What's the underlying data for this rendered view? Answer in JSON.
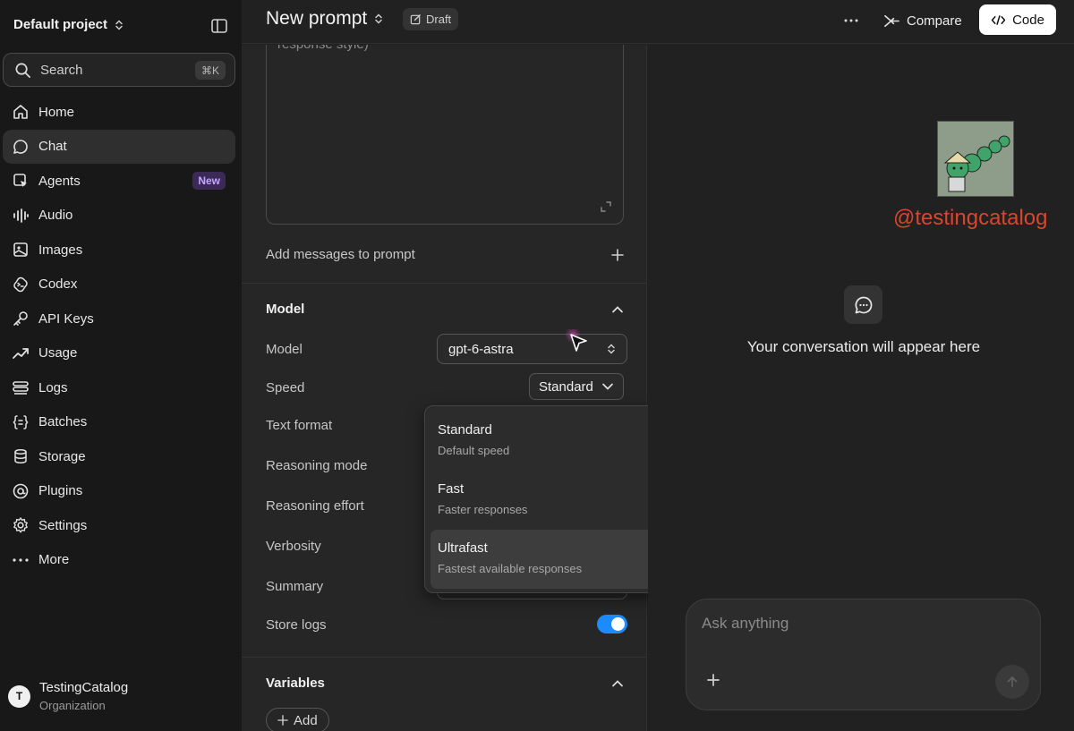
{
  "sidebar": {
    "project": "Default project",
    "search": {
      "label": "Search",
      "shortcut": "⌘K"
    },
    "items": [
      {
        "label": "Home",
        "icon": "home-icon"
      },
      {
        "label": "Chat",
        "icon": "chat-icon",
        "active": true
      },
      {
        "label": "Agents",
        "icon": "agents-icon",
        "badge": "New"
      },
      {
        "label": "Audio",
        "icon": "audio-icon"
      },
      {
        "label": "Images",
        "icon": "images-icon"
      },
      {
        "label": "Codex",
        "icon": "codex-icon"
      },
      {
        "label": "API Keys",
        "icon": "key-icon"
      },
      {
        "label": "Usage",
        "icon": "usage-icon"
      },
      {
        "label": "Logs",
        "icon": "logs-icon"
      },
      {
        "label": "Batches",
        "icon": "batches-icon"
      },
      {
        "label": "Storage",
        "icon": "storage-icon"
      },
      {
        "label": "Plugins",
        "icon": "plugins-icon"
      },
      {
        "label": "Settings",
        "icon": "settings-icon"
      },
      {
        "label": "More",
        "icon": "more-icon"
      }
    ],
    "org": {
      "initial": "T",
      "name": "TestingCatalog",
      "role": "Organization"
    }
  },
  "header": {
    "title": "New prompt",
    "status": "Draft",
    "compare_label": "Compare",
    "code_label": "Code"
  },
  "prompt": {
    "system_placeholder": "response style)",
    "add_messages_label": "Add messages to prompt"
  },
  "model_section": {
    "title": "Model",
    "model_label": "Model",
    "model_value": "gpt-6-astra",
    "speed_label": "Speed",
    "speed_value": "Standard",
    "text_format_label": "Text format",
    "reasoning_mode_label": "Reasoning mode",
    "reasoning_effort_label": "Reasoning effort",
    "verbosity_label": "Verbosity",
    "summary_label": "Summary",
    "store_logs_label": "Store logs",
    "store_logs_on": true
  },
  "speed_dropdown": {
    "options": [
      {
        "title": "Standard",
        "desc": "Default speed"
      },
      {
        "title": "Fast",
        "desc": "Faster responses"
      },
      {
        "title": "Ultrafast",
        "desc": "Fastest available responses",
        "highlighted": true
      }
    ]
  },
  "variables_section": {
    "title": "Variables",
    "add_label": "Add"
  },
  "chat": {
    "watermark": "@testingcatalog",
    "empty_text": "Your conversation will appear here",
    "composer_placeholder": "Ask anything"
  },
  "colors": {
    "accent_toggle": "#1a8cff",
    "badge_text": "#c5a6ff",
    "watermark": "#d9462b"
  }
}
